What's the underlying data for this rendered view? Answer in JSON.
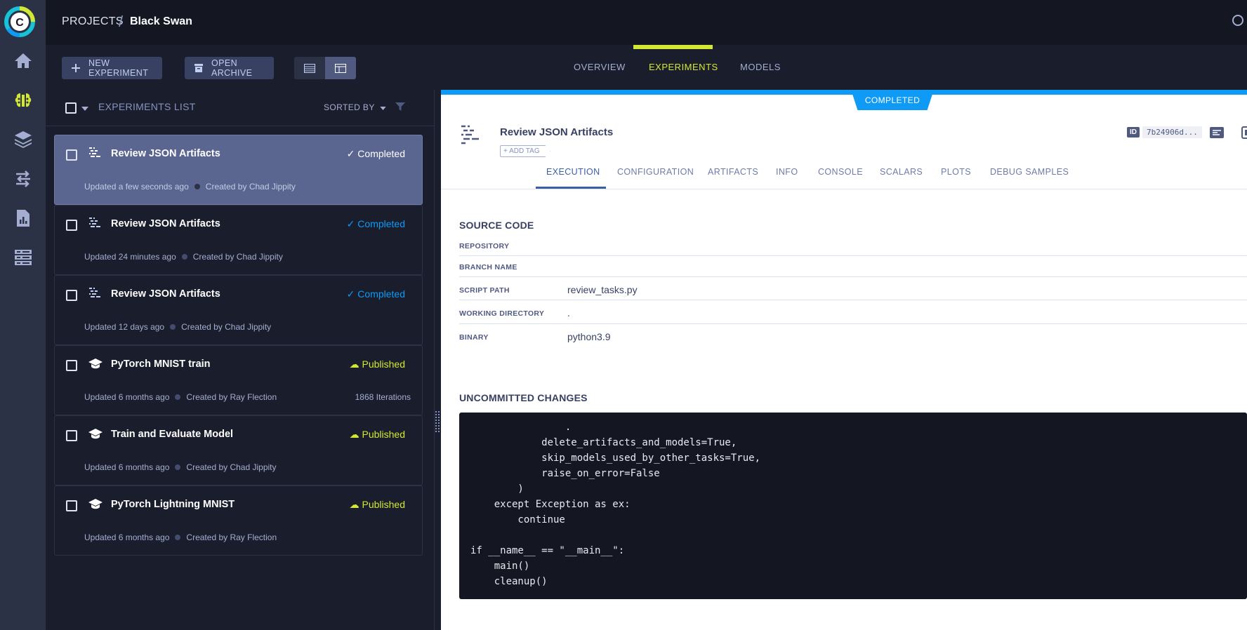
{
  "app": {
    "logo_letter": "C"
  },
  "breadcrumb": {
    "root": "PROJECTS",
    "separator": "/",
    "current": "Black Swan"
  },
  "toolbar": {
    "new_experiment": "NEW EXPERIMENT",
    "open_archive": "OPEN ARCHIVE"
  },
  "main_tabs": [
    {
      "label": "OVERVIEW",
      "active": false
    },
    {
      "label": "EXPERIMENTS",
      "active": true
    },
    {
      "label": "MODELS",
      "active": false
    }
  ],
  "list": {
    "title": "EXPERIMENTS LIST",
    "sorted_by": "SORTED BY",
    "items": [
      {
        "name": "Review JSON Artifacts",
        "status": "Completed",
        "updated": "Updated a few seconds ago",
        "created": "Created by Chad Jippity",
        "iterations": "",
        "selected": true,
        "type": "data-processing"
      },
      {
        "name": "Review JSON Artifacts",
        "status": "Completed",
        "updated": "Updated 24 minutes ago",
        "created": "Created by Chad Jippity",
        "iterations": "",
        "selected": false,
        "type": "data-processing"
      },
      {
        "name": "Review JSON Artifacts",
        "status": "Completed",
        "updated": "Updated 12 days ago",
        "created": "Created by Chad Jippity",
        "iterations": "",
        "selected": false,
        "type": "data-processing"
      },
      {
        "name": "PyTorch MNIST train",
        "status": "Published",
        "updated": "Updated 6 months ago",
        "created": "Created by Ray Flection",
        "iterations": "1868 Iterations",
        "selected": false,
        "type": "training"
      },
      {
        "name": "Train and Evaluate Model",
        "status": "Published",
        "updated": "Updated 6 months ago",
        "created": "Created by Chad Jippity",
        "iterations": "",
        "selected": false,
        "type": "training"
      },
      {
        "name": "PyTorch Lightning MNIST",
        "status": "Published",
        "updated": "Updated 6 months ago",
        "created": "Created by Ray Flection",
        "iterations": "",
        "selected": false,
        "type": "training"
      }
    ]
  },
  "details": {
    "status_banner": "COMPLETED",
    "title": "Review JSON Artifacts",
    "add_tag": "+ ADD TAG",
    "id_label": "ID",
    "id_value": "7b24906d...",
    "tabs": [
      {
        "label": "EXECUTION",
        "active": true
      },
      {
        "label": "CONFIGURATION",
        "active": false
      },
      {
        "label": "ARTIFACTS",
        "active": false
      },
      {
        "label": "INFO",
        "active": false
      },
      {
        "label": "CONSOLE",
        "active": false
      },
      {
        "label": "SCALARS",
        "active": false
      },
      {
        "label": "PLOTS",
        "active": false
      },
      {
        "label": "DEBUG SAMPLES",
        "active": false
      }
    ],
    "source_code_title": "SOURCE CODE",
    "source_code": [
      {
        "key": "REPOSITORY",
        "value": ""
      },
      {
        "key": "BRANCH NAME",
        "value": ""
      },
      {
        "key": "SCRIPT PATH",
        "value": "review_tasks.py"
      },
      {
        "key": "WORKING DIRECTORY",
        "value": "."
      },
      {
        "key": "BINARY",
        "value": "python3.9"
      }
    ],
    "uncommitted_title": "UNCOMMITTED CHANGES",
    "uncommitted_code": "                .\n            delete_artifacts_and_models=True,\n            skip_models_used_by_other_tasks=True,\n            raise_on_error=False\n        )\n    except Exception as ex:\n        continue\n\nif __name__ == \"__main__\":\n    main()\n    cleanup()"
  },
  "colors": {
    "accent": "#d2e832",
    "completed": "#0f9af5",
    "published": "#d2e832",
    "rail": "#2c3246",
    "background": "#141722"
  }
}
